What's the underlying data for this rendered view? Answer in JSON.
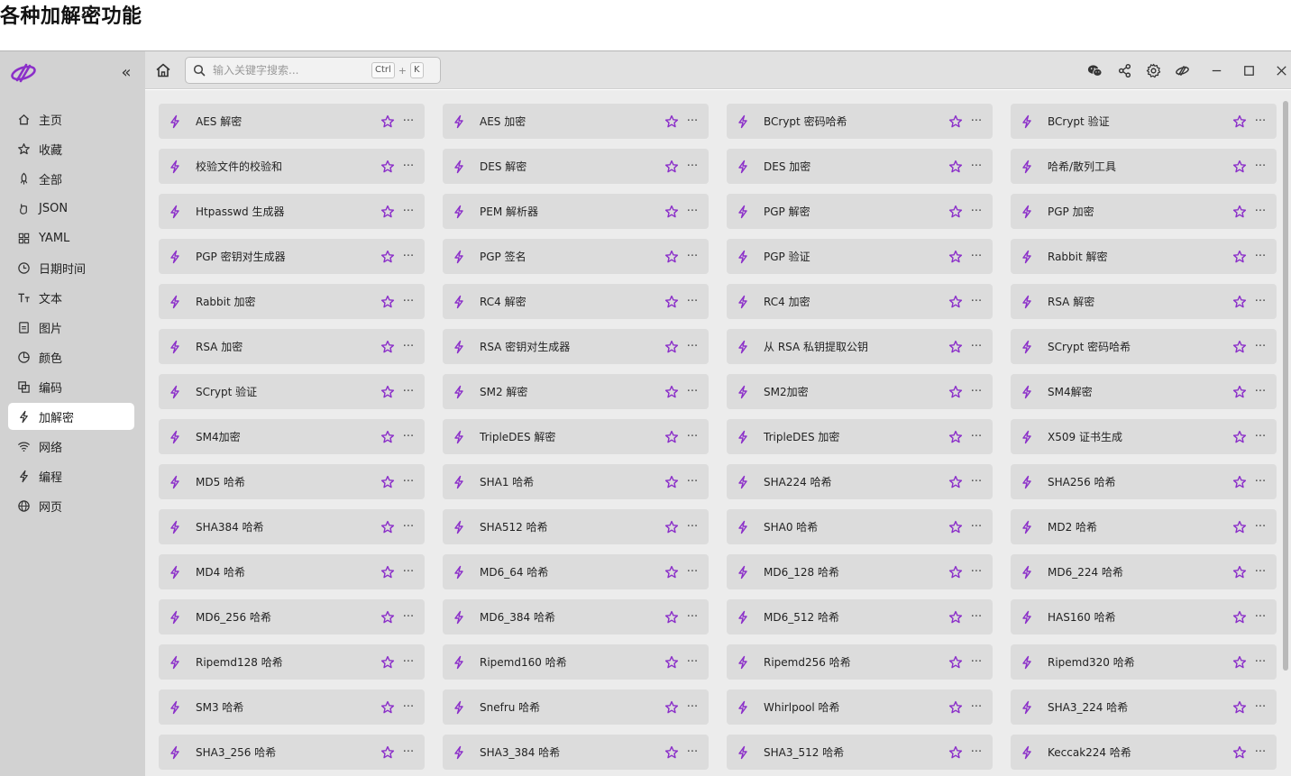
{
  "page": {
    "heading": "各种加解密功能"
  },
  "sidebar": {
    "collapse_label": "«",
    "items": [
      {
        "label": "主页",
        "icon": "home-icon"
      },
      {
        "label": "收藏",
        "icon": "star-icon"
      },
      {
        "label": "全部",
        "icon": "rocket-icon"
      },
      {
        "label": "JSON",
        "icon": "json-icon"
      },
      {
        "label": "YAML",
        "icon": "grid-icon"
      },
      {
        "label": "日期时间",
        "icon": "clock-icon"
      },
      {
        "label": "文本",
        "icon": "text-icon"
      },
      {
        "label": "图片",
        "icon": "image-icon"
      },
      {
        "label": "颜色",
        "icon": "palette-icon"
      },
      {
        "label": "编码",
        "icon": "encoding-icon"
      },
      {
        "label": "加解密",
        "icon": "bolt-icon",
        "active": true
      },
      {
        "label": "网络",
        "icon": "wifi-icon"
      },
      {
        "label": "编程",
        "icon": "bolt-icon"
      },
      {
        "label": "网页",
        "icon": "globe-icon"
      }
    ]
  },
  "toolbar": {
    "search_placeholder": "输入关键字搜索...",
    "shortcut_ctrl": "Ctrl",
    "shortcut_plus": "+",
    "shortcut_key": "K",
    "right_icons": [
      "wechat-icon",
      "share-icon",
      "settings-icon",
      "logo-icon",
      "minimize-icon",
      "maximize-icon",
      "close-icon"
    ]
  },
  "tools": {
    "more_label": "···",
    "items": [
      "AES 解密",
      "AES 加密",
      "BCrypt 密码哈希",
      "BCrypt 验证",
      "校验文件的校验和",
      "DES 解密",
      "DES 加密",
      "哈希/散列工具",
      "Htpasswd 生成器",
      "PEM 解析器",
      "PGP 解密",
      "PGP 加密",
      "PGP 密钥对生成器",
      "PGP 签名",
      "PGP 验证",
      "Rabbit 解密",
      "Rabbit 加密",
      "RC4 解密",
      "RC4 加密",
      "RSA 解密",
      "RSA 加密",
      "RSA 密钥对生成器",
      "从 RSA 私钥提取公钥",
      "SCrypt 密码哈希",
      "SCrypt 验证",
      "SM2 解密",
      "SM2加密",
      "SM4解密",
      "SM4加密",
      "TripleDES 解密",
      "TripleDES 加密",
      "X509 证书生成",
      "MD5 哈希",
      "SHA1 哈希",
      "SHA224 哈希",
      "SHA256 哈希",
      "SHA384 哈希",
      "SHA512 哈希",
      "SHA0 哈希",
      "MD2 哈希",
      "MD4 哈希",
      "MD6_64 哈希",
      "MD6_128 哈希",
      "MD6_224 哈希",
      "MD6_256 哈希",
      "MD6_384 哈希",
      "MD6_512 哈希",
      "HAS160 哈希",
      "Ripemd128 哈希",
      "Ripemd160 哈希",
      "Ripemd256 哈希",
      "Ripemd320 哈希",
      "SM3 哈希",
      "Snefru 哈希",
      "Whirlpool 哈希",
      "SHA3_224 哈希",
      "SHA3_256 哈希",
      "SHA3_384 哈希",
      "SHA3_512 哈希",
      "Keccak224 哈希"
    ]
  },
  "colors": {
    "accent_purple": "#8b2fc9",
    "sidebar_bg": "#d2d2d2",
    "content_bg": "#ececec",
    "card_bg": "#dcdcdc"
  }
}
